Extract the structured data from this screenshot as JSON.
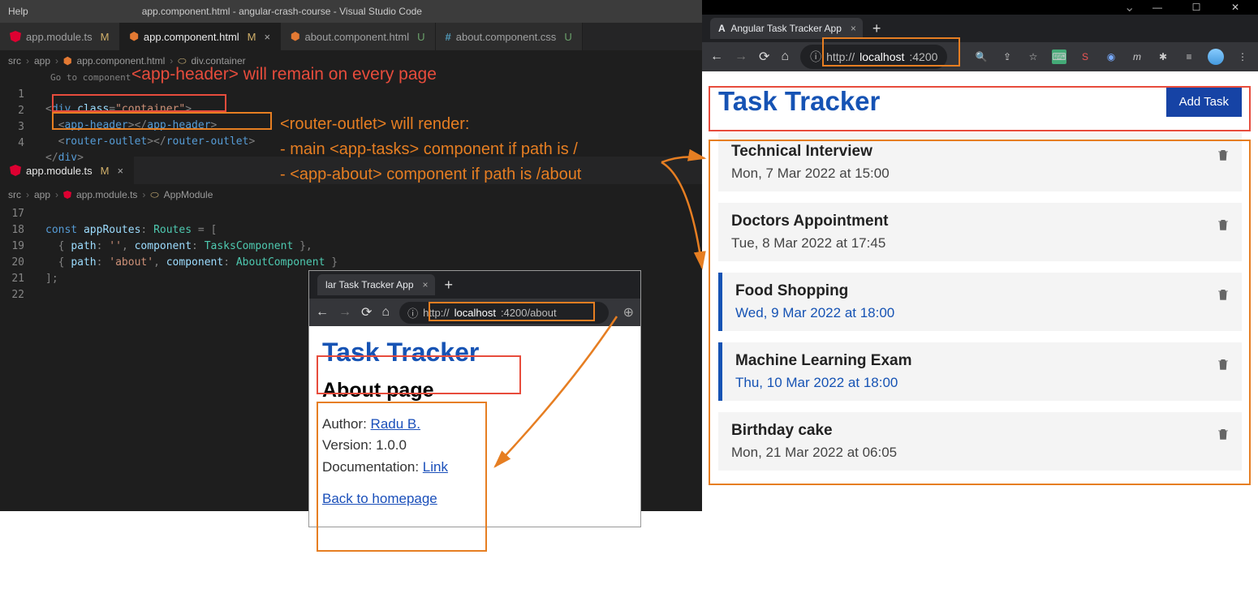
{
  "vscode": {
    "title_help": "Help",
    "title_center": "app.component.html - angular-crash-course - Visual Studio Code",
    "tabs_top": [
      {
        "icon": "ang",
        "name": "app.module.ts",
        "mod": "M"
      },
      {
        "icon": "html",
        "name": "app.component.html",
        "mod": "M",
        "active": true,
        "close": true
      },
      {
        "icon": "html",
        "name": "about.component.html",
        "mod": "U"
      },
      {
        "icon": "css",
        "name": "about.component.css",
        "mod": "U"
      }
    ],
    "crumbs_top": "src › app › app.component.html › div.container",
    "go_to_component": "Go to component",
    "editor1_lines": [
      "1",
      "2",
      "3",
      "4"
    ],
    "tabs_bot": {
      "icon": "ang",
      "name": "app.module.ts",
      "mod": "M",
      "close": true
    },
    "crumbs_bot": "src › app › app.module.ts › AppModule",
    "editor2_lines": [
      "17",
      "18",
      "19",
      "20",
      "21",
      "22"
    ]
  },
  "annotations": {
    "red1": "<app-header> will remain on every page",
    "or1": "<router-outlet> will render:",
    "or2": "- main <app-tasks> component if path is /",
    "or3": "- <app-about> component if path is /about"
  },
  "browser_sm": {
    "tab_title": "lar Task Tracker App",
    "url_prefix": "http://",
    "url_host": "localhost",
    "url_path": ":4200/about",
    "h1": "Task Tracker",
    "about_title": "About page",
    "author_label": "Author: ",
    "author_link": "Radu B.",
    "version": "Version: 1.0.0",
    "doc_label": "Documentation: ",
    "doc_link": "Link",
    "back": "Back to homepage"
  },
  "browser_lg": {
    "tab_title": "Angular Task Tracker App",
    "url_prefix": "http://",
    "url_host": "localhost",
    "url_path": ":4200",
    "h1": "Task Tracker",
    "add_btn": "Add Task",
    "tasks": [
      {
        "title": "Technical Interview",
        "date": "Mon, 7 Mar 2022 at 15:00",
        "reminder": false
      },
      {
        "title": "Doctors Appointment",
        "date": "Tue, 8 Mar 2022 at 17:45",
        "reminder": false
      },
      {
        "title": "Food Shopping",
        "date": "Wed, 9 Mar 2022 at 18:00",
        "reminder": true
      },
      {
        "title": "Machine Learning Exam",
        "date": "Thu, 10 Mar 2022 at 18:00",
        "reminder": true
      },
      {
        "title": "Birthday cake",
        "date": "Mon, 21 Mar 2022 at 06:05",
        "reminder": false
      }
    ]
  }
}
